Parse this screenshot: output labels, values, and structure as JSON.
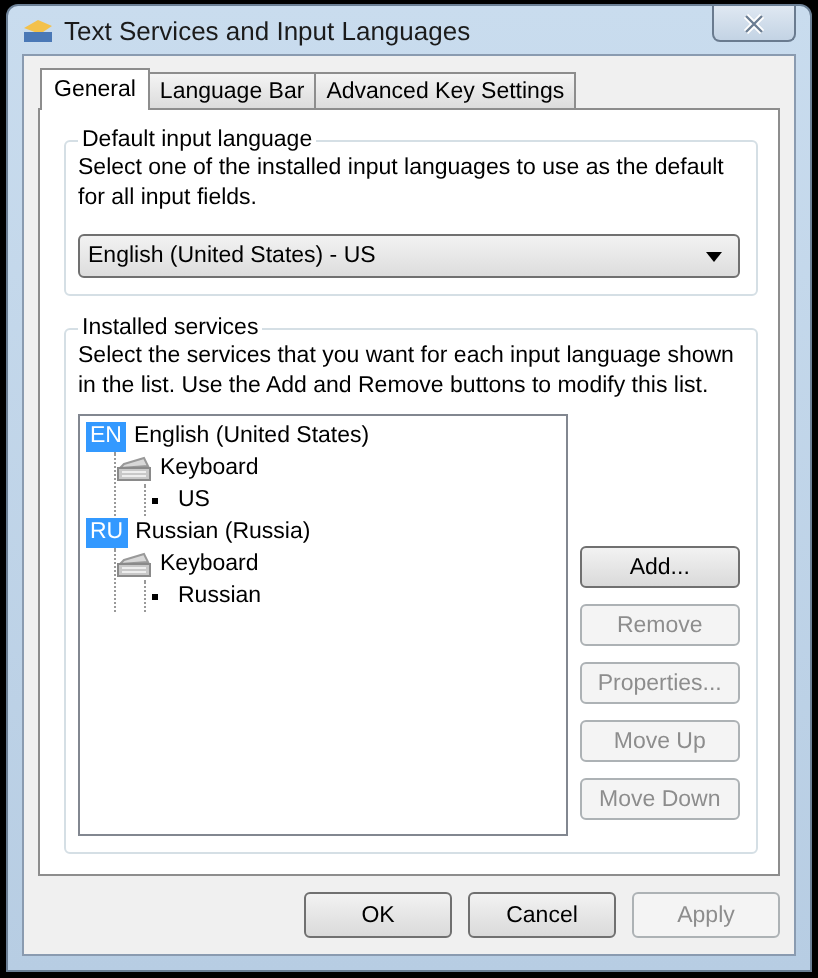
{
  "window": {
    "title": "Text Services and Input Languages"
  },
  "tabs": [
    {
      "label": "General",
      "selected": true
    },
    {
      "label": "Language Bar",
      "selected": false
    },
    {
      "label": "Advanced Key Settings",
      "selected": false
    }
  ],
  "default_input_language": {
    "title": "Default input language",
    "description": "Select one of the installed input languages to use as the default for all input fields.",
    "dropdown": {
      "value": "English (United States) - US"
    }
  },
  "installed_services": {
    "title": "Installed services",
    "description": "Select the services that you want for each input language shown in the list. Use the Add and Remove buttons to modify this list.",
    "tree": [
      {
        "code": "EN",
        "label": "English (United States)",
        "children": [
          {
            "kind": "category",
            "label": "Keyboard",
            "children": [
              {
                "kind": "layout",
                "label": "US"
              }
            ]
          }
        ]
      },
      {
        "code": "RU",
        "label": "Russian (Russia)",
        "children": [
          {
            "kind": "category",
            "label": "Keyboard",
            "children": [
              {
                "kind": "layout",
                "label": "Russian"
              }
            ]
          }
        ]
      }
    ],
    "buttons": [
      {
        "label": "Add...",
        "disabled": false
      },
      {
        "label": "Remove",
        "disabled": true
      },
      {
        "label": "Properties...",
        "disabled": true
      },
      {
        "label": "Move Up",
        "disabled": true
      },
      {
        "label": "Move Down",
        "disabled": true
      }
    ]
  },
  "footer_buttons": [
    {
      "label": "OK",
      "disabled": false
    },
    {
      "label": "Cancel",
      "disabled": false
    },
    {
      "label": "Apply",
      "disabled": true
    }
  ]
}
